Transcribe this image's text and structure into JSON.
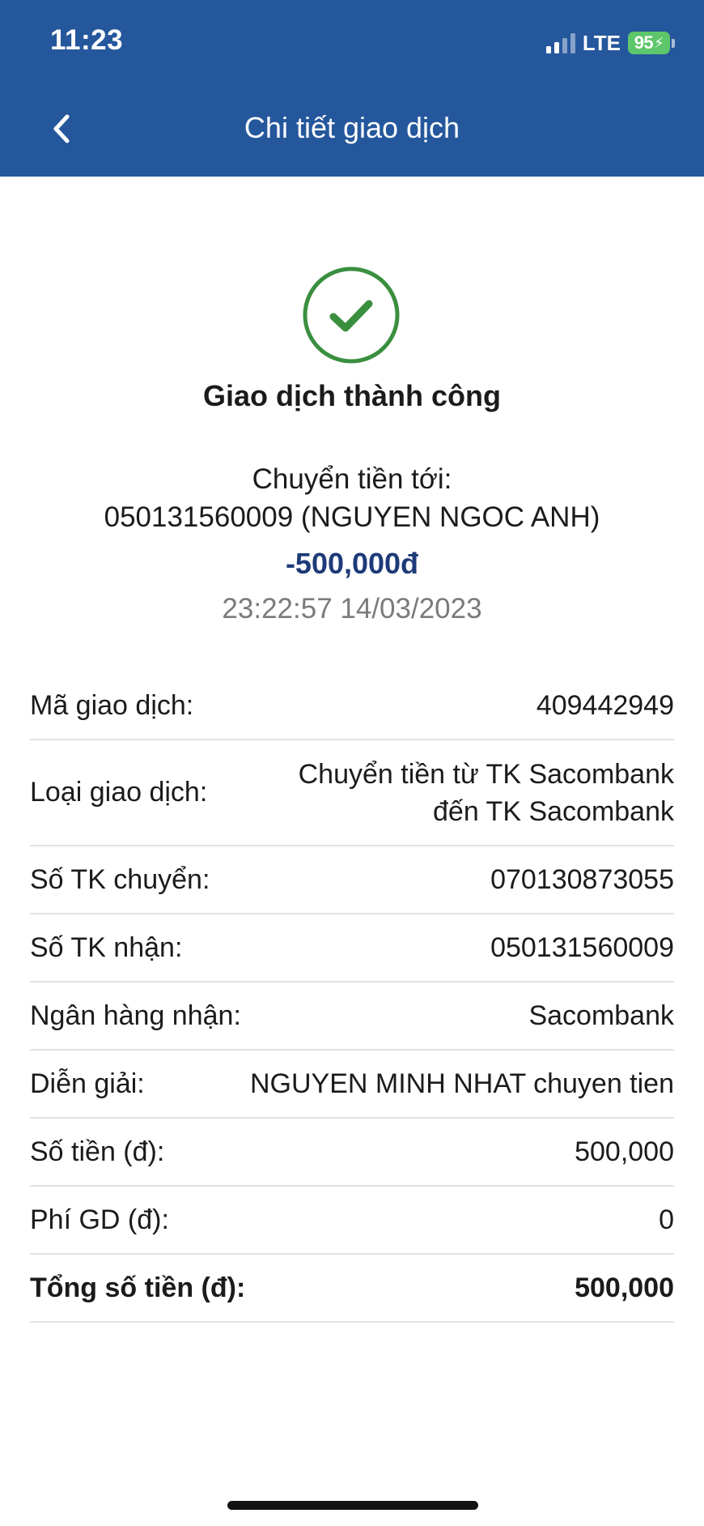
{
  "status_bar": {
    "time": "11:23",
    "network": "LTE",
    "battery": "95",
    "signal_bars_active": 2,
    "signal_bars_total": 4
  },
  "header": {
    "title": "Chi tiết giao dịch",
    "back_icon": "chevron-left-icon",
    "background_color": "#25579c"
  },
  "result": {
    "icon": "check-circle-icon",
    "icon_color": "#3a8f3f",
    "title": "Giao dịch thành công"
  },
  "summary": {
    "transfer_label": "Chuyển tiền tới:",
    "recipient": "050131560009 (NGUYEN NGOC ANH)",
    "amount": "-500,000đ",
    "amount_color": "#1e3a78",
    "timestamp": "23:22:57 14/03/2023"
  },
  "details": [
    {
      "label": "Mã giao dịch:",
      "value": "409442949"
    },
    {
      "label": "Loại giao dịch:",
      "value_line1": "Chuyển tiền từ TK Sacombank",
      "value_line2": "đến TK Sacombank"
    },
    {
      "label": "Số TK chuyển:",
      "value": "070130873055"
    },
    {
      "label": "Số TK nhận:",
      "value": "050131560009"
    },
    {
      "label": "Ngân hàng nhận:",
      "value": "Sacombank"
    },
    {
      "label": "Diễn giải:",
      "value": "NGUYEN MINH NHAT chuyen tien"
    },
    {
      "label": "Số tiền (đ):",
      "value": "500,000"
    },
    {
      "label": "Phí GD (đ):",
      "value": "0"
    },
    {
      "label": "Tổng số tiền (đ):",
      "value": "500,000"
    }
  ]
}
